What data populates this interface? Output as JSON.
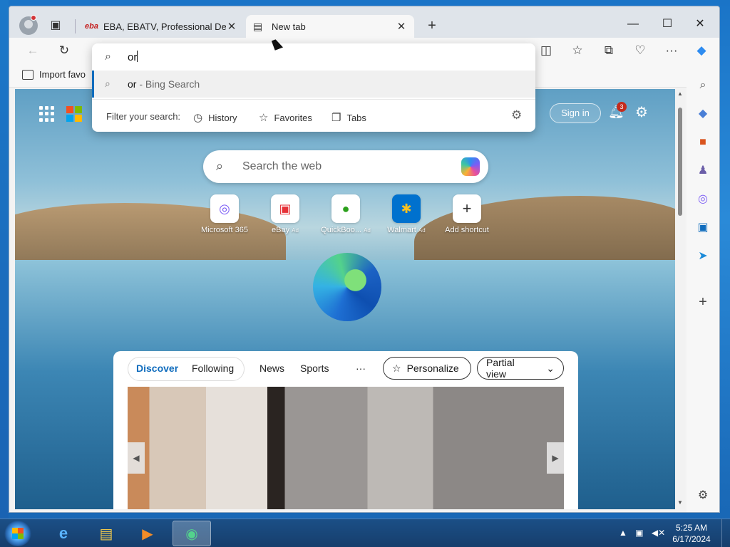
{
  "tabs": [
    {
      "title": "EBA, EBATV, Professional Develop",
      "favicon": "eba-logo-icon"
    },
    {
      "title": "New tab",
      "favicon": "newtab-icon"
    }
  ],
  "omnibox": {
    "typed": "or",
    "suggestion": {
      "term": "or",
      "suffix": " - Bing Search"
    },
    "filter_label": "Filter your search:",
    "filters": [
      "History",
      "Favorites",
      "Tabs"
    ]
  },
  "favorites_bar": {
    "import_label": "Import favo"
  },
  "ntp": {
    "search_placeholder": "Search the web",
    "sign_in": "Sign in",
    "notification_count": "3",
    "shortcuts": [
      {
        "name": "Microsoft 365",
        "ad": ""
      },
      {
        "name": "eBay",
        "ad": "Ad"
      },
      {
        "name": "QuickBoo...",
        "ad": "Ad"
      },
      {
        "name": "Walmart",
        "ad": "Ad"
      },
      {
        "name": "Add shortcut",
        "ad": ""
      }
    ]
  },
  "feed": {
    "tabs": [
      "Discover",
      "Following",
      "News",
      "Sports",
      "···"
    ],
    "personalize": "Personalize",
    "view": "Partial view"
  },
  "taskbar": {
    "time": "5:25 AM",
    "date": "6/17/2024"
  },
  "colors": {
    "accent": "#0f6cbd",
    "discover": "#0f6cbd"
  }
}
